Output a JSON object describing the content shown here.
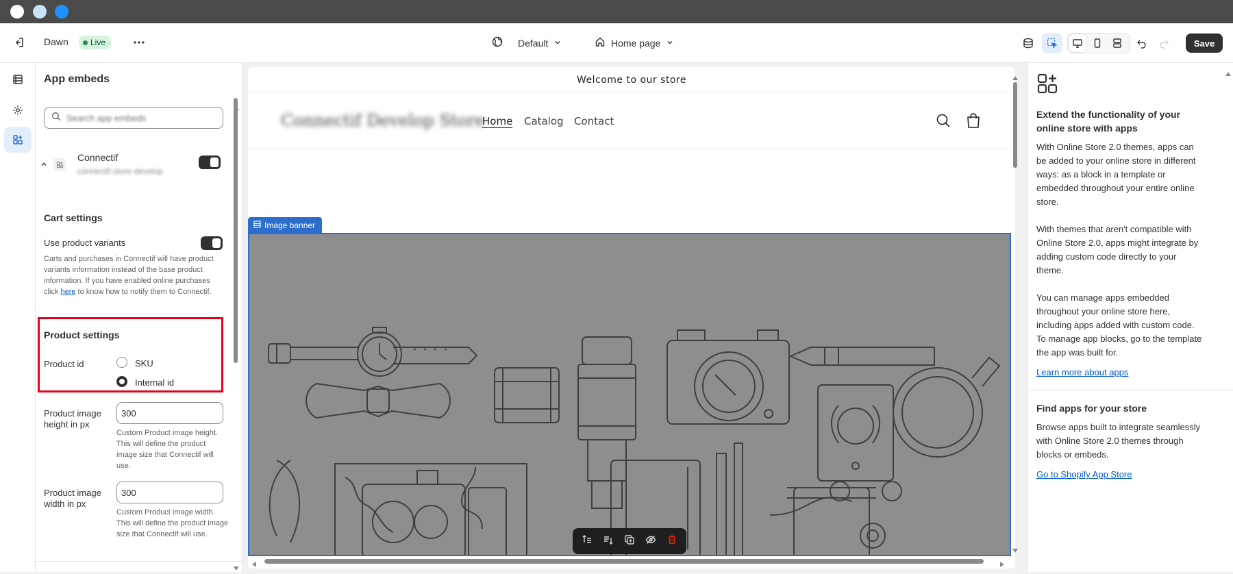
{
  "window": {
    "traffic_lights": [
      "#ffffff",
      "#c6e2f7",
      "#1e90ff"
    ]
  },
  "topbar": {
    "theme_name": "Dawn",
    "live_badge": "Live",
    "more_icon": "more-horizontal-icon",
    "exit_icon": "exit-icon",
    "market_selector": "Default",
    "page_selector": "Home page",
    "save_label": "Save"
  },
  "rail": {
    "items": [
      {
        "name": "sections",
        "icon": "sections-icon"
      },
      {
        "name": "theme-settings",
        "icon": "gear-icon"
      },
      {
        "name": "app-embeds",
        "icon": "apps-icon"
      }
    ]
  },
  "panel": {
    "title": "App embeds",
    "search_placeholder": "Search app embeds",
    "app": {
      "name": "Connectif",
      "handle": "connectif-store-develop"
    },
    "cart_settings": {
      "title": "Cart settings",
      "use_variants_label": "Use product variants",
      "help_before": "Carts and purchases in Connectif will have product variants information instead of the base product information. If you have enabled online purchases click ",
      "help_link": "here",
      "help_after": " to know how to notify them to Connectif."
    },
    "product_settings": {
      "title": "Product settings",
      "product_id_label": "Product id",
      "options": [
        "SKU",
        "Internal id"
      ],
      "selected": "Internal id",
      "height_label": "Product image height in px",
      "height_value": "300",
      "height_help": "Custom Product image height. This will define the product image size that Connectif will use.",
      "width_label": "Product image width in px",
      "width_value": "300",
      "width_help": "Custom Product image width. This will define the product image size that Connectif will use."
    }
  },
  "preview": {
    "announcement": "Welcome to our store",
    "logo": "Connectif Develop Store",
    "nav": [
      "Home",
      "Catalog",
      "Contact"
    ],
    "banner_tag": "Image banner",
    "toolbar_icons": [
      "move-up-icon",
      "move-down-icon",
      "duplicate-icon",
      "hide-icon",
      "delete-icon"
    ]
  },
  "right_panel": {
    "heading1": "Extend the functionality of your online store with apps",
    "p1": "With Online Store 2.0 themes, apps can be added to your online store in different ways: as a block in a template or embedded throughout your entire online store.",
    "p2": "With themes that aren't compatible with Online Store 2.0, apps might integrate by adding custom code directly to your theme.",
    "p3": "You can manage apps embedded throughout your online store here, including apps added with custom code. To manage app blocks, go to the template the app was built for.",
    "link1": "Learn more about apps",
    "heading2": "Find apps for your store",
    "p4": "Browse apps built to integrate seamlessly with Online Store 2.0 themes through blocks or embeds.",
    "link2": "Go to Shopify App Store"
  }
}
